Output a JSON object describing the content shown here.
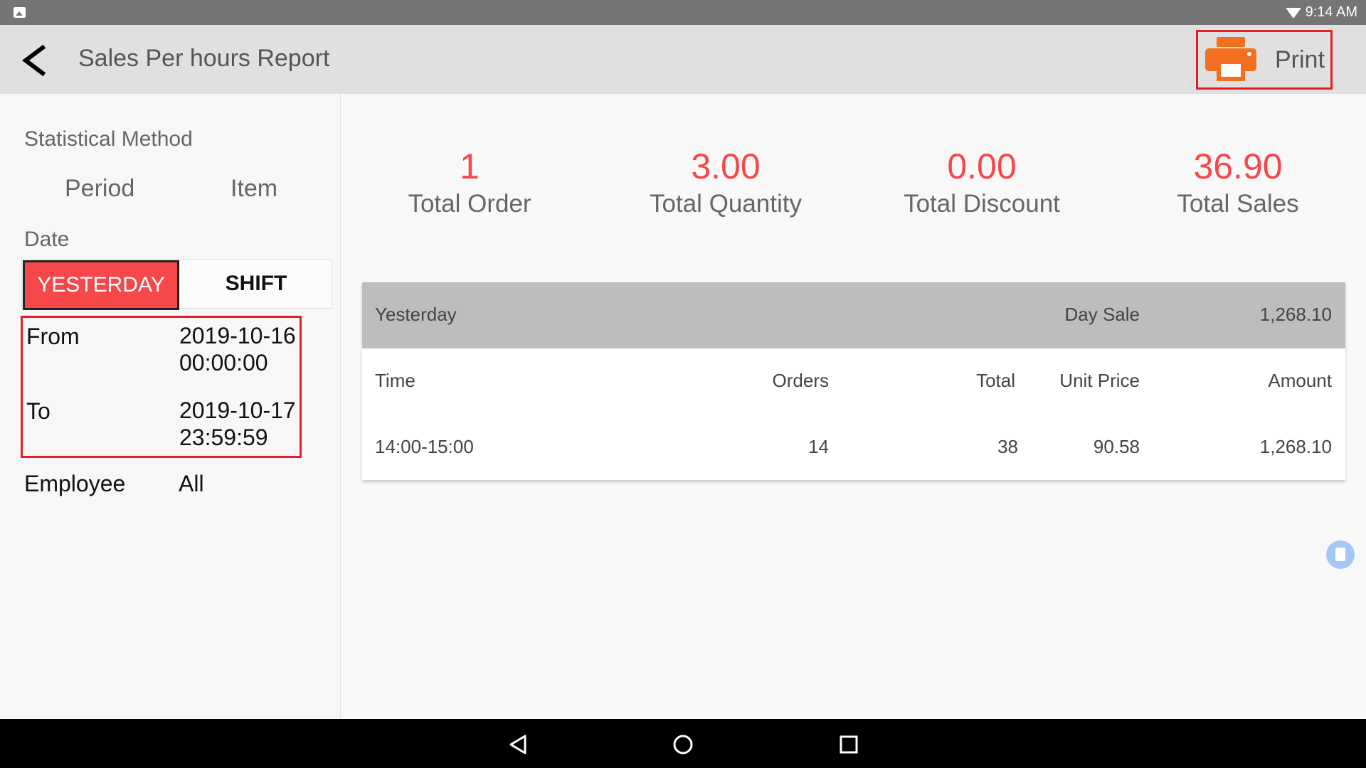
{
  "status_bar": {
    "time": "9:14 AM",
    "icons": [
      "image-icon",
      "wifi-icon"
    ]
  },
  "toolbar": {
    "title": "Sales Per hours Report",
    "print_label": "Print",
    "print_icon_color": "#f37021"
  },
  "filters": {
    "statistical_method_label": "Statistical Method",
    "methods": [
      "Period",
      "Item"
    ],
    "date_label": "Date",
    "date_options": [
      "YESTERDAY",
      "SHIFT"
    ],
    "selected_date_option": "YESTERDAY",
    "from_label": "From",
    "from_date": "2019-10-16",
    "from_time": "00:00:00",
    "to_label": "To",
    "to_date": "2019-10-17",
    "to_time": "23:59:59",
    "employee_label": "Employee",
    "employee_value": "All"
  },
  "summary": [
    {
      "value": "1",
      "label": "Total Order"
    },
    {
      "value": "3.00",
      "label": "Total Quantity"
    },
    {
      "value": "0.00",
      "label": "Total Discount"
    },
    {
      "value": "36.90",
      "label": "Total Sales"
    }
  ],
  "table": {
    "group_label": "Yesterday",
    "day_sale_label": "Day Sale",
    "day_sale_value": "1,268.10",
    "columns": [
      "Time",
      "Orders",
      "Total",
      "Unit Price",
      "Amount"
    ],
    "rows": [
      [
        "14:00-15:00",
        "14",
        "38",
        "90.58",
        "1,268.10"
      ]
    ]
  },
  "colors": {
    "accent": "#f6474a",
    "highlight_box": "#e32028",
    "toolbar_bg": "#e0e0e0",
    "table_header_bg": "#bdbdbd"
  }
}
